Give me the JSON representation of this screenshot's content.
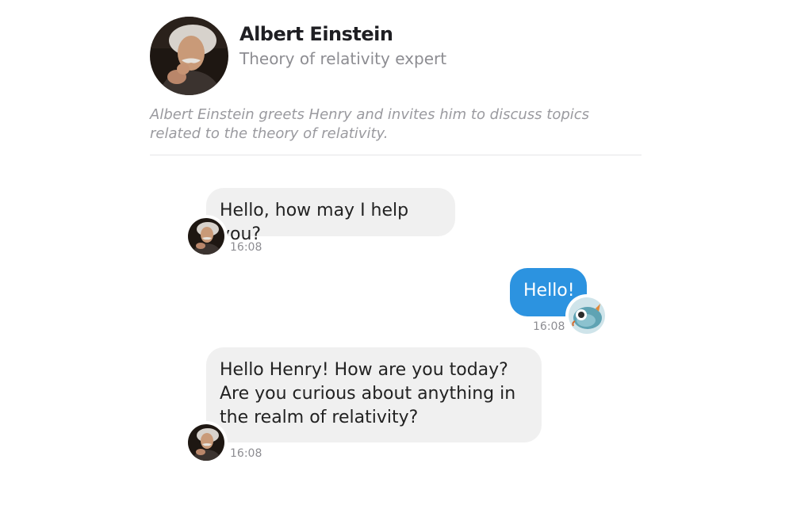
{
  "profile": {
    "name": "Albert Einstein",
    "role": "Theory of relativity expert",
    "description": "Albert Einstein greets Henry and invites him to discuss topics related to the theory of relativity."
  },
  "messages": [
    {
      "sender": "bot",
      "text": "Hello, how may I help you?",
      "time": "16:08"
    },
    {
      "sender": "user",
      "text": "Hello!",
      "time": "16:08"
    },
    {
      "sender": "bot",
      "text": "Hello Henry! How are you today? Are you curious about anything in the realm of relativity?",
      "time": "16:08"
    }
  ],
  "colors": {
    "outgoing_bubble": "#2c93e0",
    "incoming_bubble": "#f0f0f0",
    "muted_text": "#8d8d92"
  }
}
